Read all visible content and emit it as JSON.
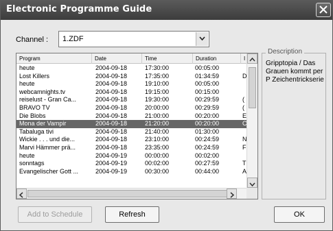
{
  "window": {
    "title": "Electronic Programme Guide"
  },
  "channel": {
    "label": "Channel :",
    "value": "1.ZDF"
  },
  "columns": [
    "Program",
    "Date",
    "Time",
    "Duration",
    "I"
  ],
  "rows": [
    [
      "heute",
      "2004-09-18",
      "17:30:00",
      "00:05:00",
      ""
    ],
    [
      "Lost Killers",
      "2004-09-18",
      "17:35:00",
      "01:34:59",
      "D"
    ],
    [
      "heute",
      "2004-09-18",
      "19:10:00",
      "00:05:00",
      ""
    ],
    [
      "webcamnights.tv",
      "2004-09-18",
      "19:15:00",
      "00:15:00",
      ""
    ],
    [
      "reiselust - Gran Ca...",
      "2004-09-18",
      "19:30:00",
      "00:29:59",
      "("
    ],
    [
      "BRAVO TV",
      "2004-09-18",
      "20:00:00",
      "00:29:59",
      "("
    ],
    [
      "Die Blobs",
      "2004-09-18",
      "21:00:00",
      "00:20:00",
      "E"
    ],
    [
      "Mona der Vampir",
      "2004-09-18",
      "21:20:00",
      "00:20:00",
      "C"
    ],
    [
      "Tabaluga tivi",
      "2004-09-18",
      "21:40:00",
      "01:30:00",
      ""
    ],
    [
      "Wickie . . . und die...",
      "2004-09-18",
      "23:10:00",
      "00:24:59",
      "N"
    ],
    [
      "Marvi Hämmer prä...",
      "2004-09-18",
      "23:35:00",
      "00:24:59",
      "F"
    ],
    [
      "heute",
      "2004-09-19",
      "00:00:00",
      "00:02:00",
      ""
    ],
    [
      "sonntags",
      "2004-09-19",
      "00:02:00",
      "00:27:59",
      "T"
    ],
    [
      "Evangelischer Gott ...",
      "2004-09-19",
      "00:30:00",
      "00:44:00",
      "A"
    ]
  ],
  "selected_row": 7,
  "description": {
    "label": "Description",
    "text": "Gripptopia / Das Grauen kommt per P Zeichentrickserie"
  },
  "buttons": {
    "add": "Add to Schedule",
    "refresh": "Refresh",
    "ok": "OK"
  }
}
